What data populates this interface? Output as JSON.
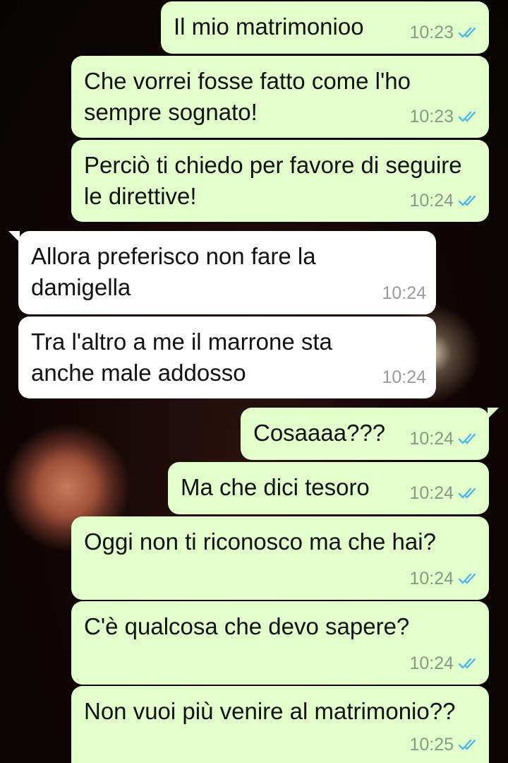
{
  "messages": [
    {
      "text": "Il mio matrimonioo",
      "time": "10:23"
    },
    {
      "text": "Che vorrei fosse fatto come l'ho sempre sognato!",
      "time": "10:23"
    },
    {
      "text": "Perciò ti chiedo per favore di seguire le direttive!",
      "time": "10:24"
    },
    {
      "text": "Allora preferisco non fare la damigella",
      "time": "10:24"
    },
    {
      "text": "Tra l'altro a me il marrone sta anche male addosso",
      "time": "10:24"
    },
    {
      "text": "Cosaaaa???",
      "time": "10:24"
    },
    {
      "text": "Ma che dici tesoro",
      "time": "10:24"
    },
    {
      "text": "Oggi non ti riconosco ma che hai?",
      "time": "10:24"
    },
    {
      "text": "C'è qualcosa che devo sapere?",
      "time": "10:24"
    },
    {
      "text": "Non vuoi più venire al matrimonio??",
      "time": "10:25"
    }
  ],
  "colors": {
    "outgoing_bubble": "#e2fecb",
    "incoming_bubble": "#ffffff",
    "read_tick": "#4fb6ec"
  },
  "icons": {
    "read_status": "double-check-icon"
  }
}
